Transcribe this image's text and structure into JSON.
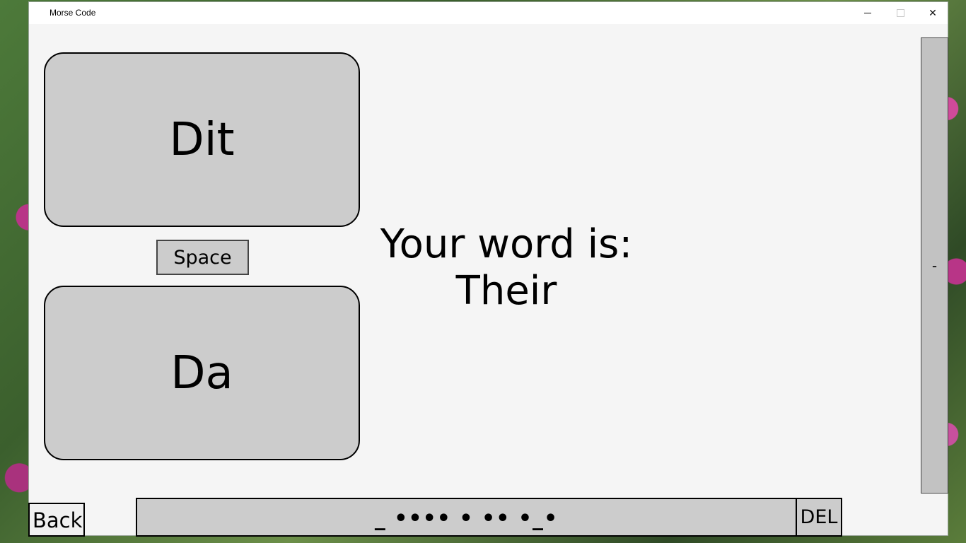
{
  "window": {
    "title": "Morse Code",
    "close_glyph": "✕"
  },
  "buttons": {
    "dit": "Dit",
    "da": "Da",
    "space": "Space",
    "back": "Back",
    "del": "DEL"
  },
  "prompt": {
    "label": "Your word is:",
    "word": "Their"
  },
  "scrollbar": {
    "glyph": "-"
  },
  "code_display": {
    "value": "_ •••• • •• •_•"
  },
  "icons": {
    "minimize": "minimize-icon",
    "maximize": "maximize-icon",
    "close": "close-icon"
  }
}
